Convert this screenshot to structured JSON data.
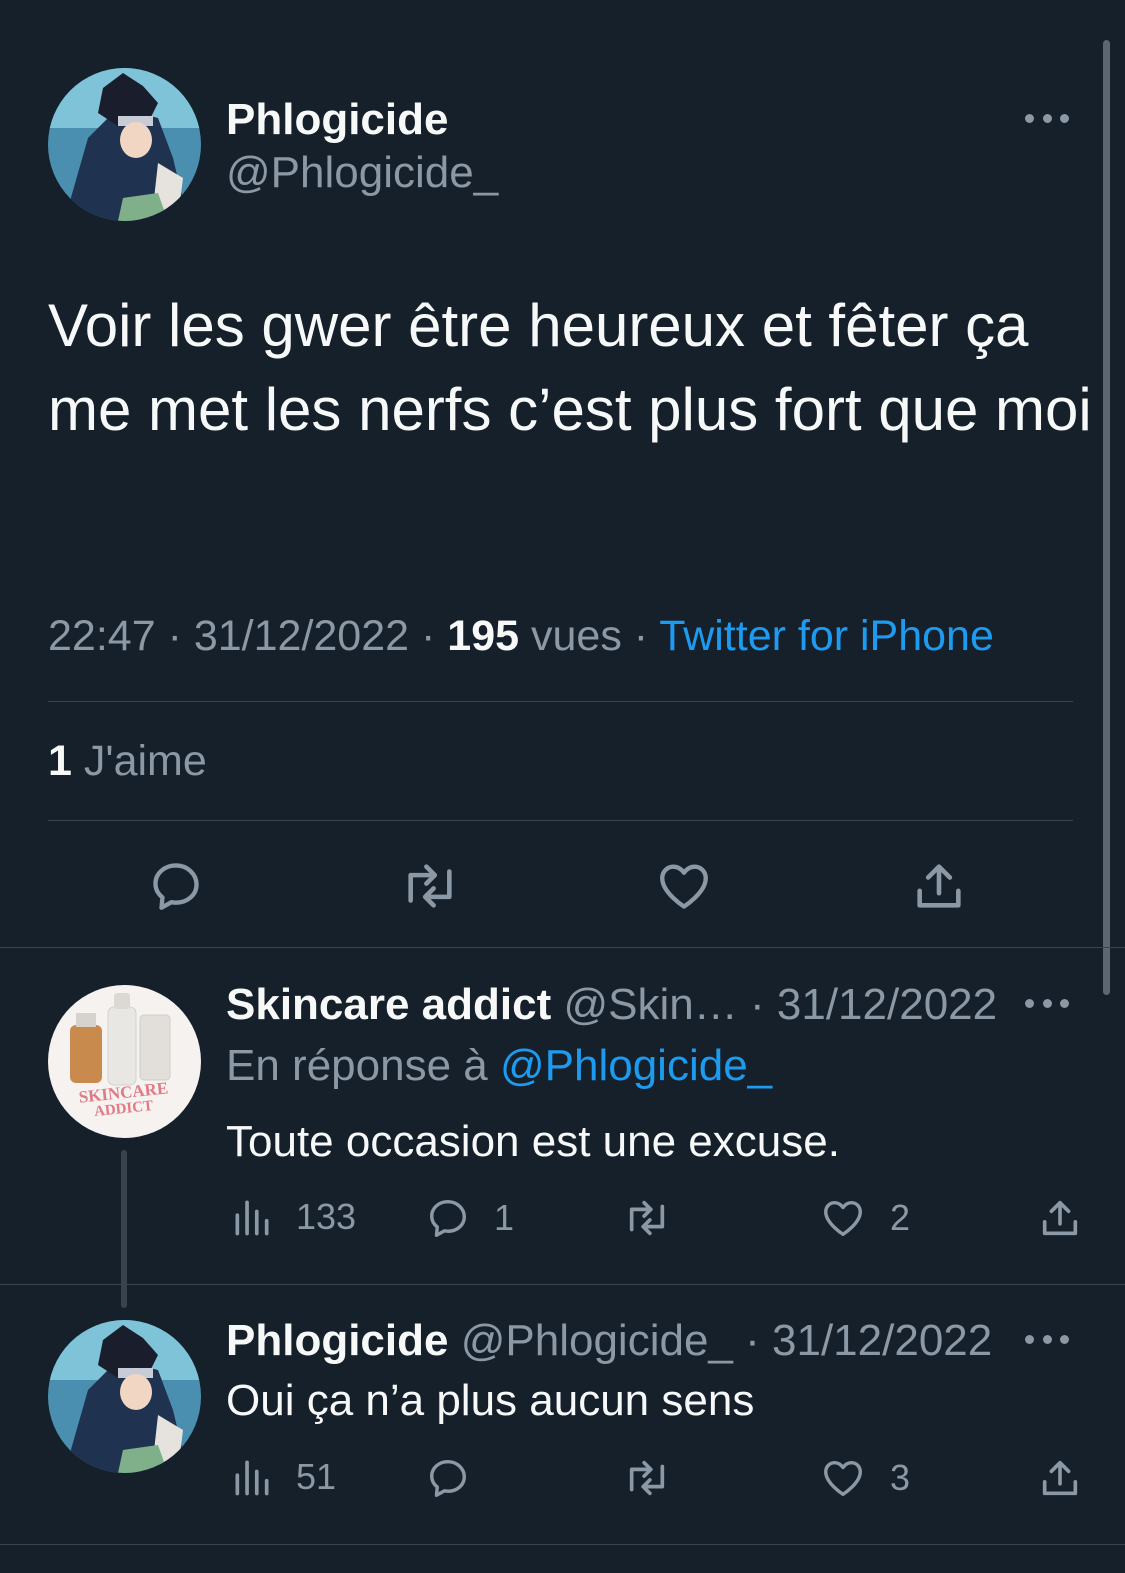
{
  "main_tweet": {
    "author_name": "Phlogicide",
    "author_handle": "@Phlogicide_",
    "text": "Voir les gwer être heureux et fêter ça me met les nerfs c’est plus fort que moi",
    "time": "22:47",
    "date": "31/12/2022",
    "views_count": "195",
    "views_label": "vues",
    "source": "Twitter for iPhone",
    "likes_count": "1",
    "likes_label": "J'aime"
  },
  "replies": [
    {
      "author_name": "Skincare addict",
      "author_handle": "@Skin…",
      "date": "31/12/2022",
      "reply_to_label": "En réponse à",
      "reply_to_handle": "@Phlogicide_",
      "avatar_text_1": "SKINCARE",
      "avatar_text_2": "ADDICT",
      "text": "Toute occasion est une excuse.",
      "views": "133",
      "replies": "1",
      "retweets": "",
      "likes": "2"
    },
    {
      "author_name": "Phlogicide",
      "author_handle": "@Phlogicide_",
      "date": "31/12/2022",
      "text": "Oui ça n’a plus aucun sens",
      "views": "51",
      "replies": "",
      "retweets": "",
      "likes": "3"
    }
  ],
  "colors": {
    "background": "#15202b",
    "text_primary": "#f7f9f9",
    "text_secondary": "#8b98a5",
    "accent": "#1d9bf0",
    "divider": "#38444d"
  },
  "icons": [
    "more-icon",
    "reply-icon",
    "retweet-icon",
    "like-icon",
    "share-icon",
    "views-icon"
  ]
}
